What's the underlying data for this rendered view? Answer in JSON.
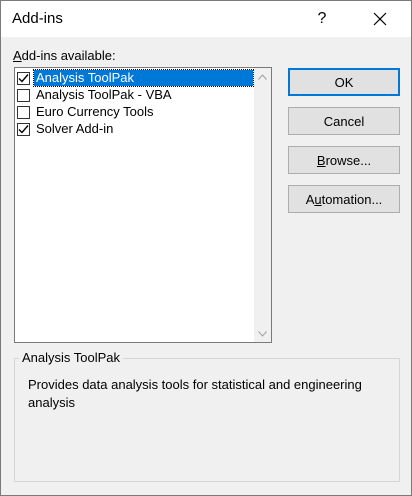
{
  "dialog": {
    "title": "Add-ins",
    "help_label": "?"
  },
  "list": {
    "label_accel": "A",
    "label_rest": "dd-ins available:",
    "items": [
      {
        "label": "Analysis ToolPak",
        "checked": true,
        "selected": true
      },
      {
        "label": "Analysis ToolPak - VBA",
        "checked": false,
        "selected": false
      },
      {
        "label": "Euro Currency Tools",
        "checked": false,
        "selected": false
      },
      {
        "label": "Solver Add-in",
        "checked": true,
        "selected": false
      }
    ]
  },
  "buttons": {
    "ok": "OK",
    "cancel": "Cancel",
    "browse_accel": "B",
    "browse_rest": "rowse...",
    "automation_pre": "A",
    "automation_accel": "u",
    "automation_rest": "tomation..."
  },
  "description": {
    "title": "Analysis ToolPak",
    "text": "Provides data analysis tools for statistical and engineering analysis"
  },
  "colors": {
    "selection": "#0078d7",
    "default_button_border": "#0078d7",
    "dialog_bg": "#f0f0f0"
  },
  "icons": {
    "close": "close-icon",
    "scroll_up": "chevron-up-icon",
    "scroll_down": "chevron-down-icon",
    "check": "checkmark-icon"
  }
}
